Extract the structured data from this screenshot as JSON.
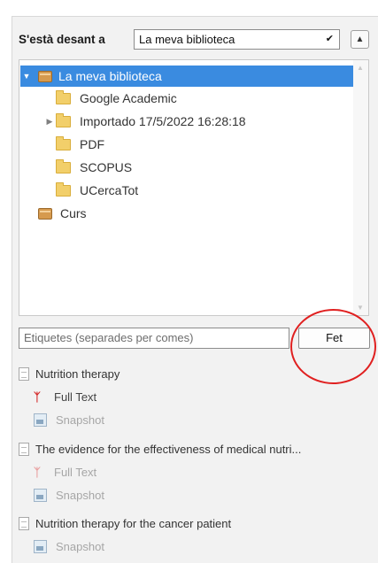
{
  "saving": {
    "label": "S'està desant a",
    "library_select": "La meva biblioteca",
    "collapse_icon": "chevron-up-icon"
  },
  "tree": {
    "items": [
      {
        "label": "La meva biblioteca",
        "type": "library",
        "expanded": true,
        "selected": true
      },
      {
        "label": "Google Academic",
        "type": "collection"
      },
      {
        "label": "Importado 17/5/2022 16:28:18",
        "type": "collection",
        "expanded": false
      },
      {
        "label": "PDF",
        "type": "collection"
      },
      {
        "label": "SCOPUS",
        "type": "collection"
      },
      {
        "label": "UCercaTot",
        "type": "collection"
      },
      {
        "label": "Curs",
        "type": "library"
      }
    ]
  },
  "tags": {
    "placeholder": "Etiquetes (separades per comes)",
    "done_label": "Fet"
  },
  "items": [
    {
      "title": "Nutrition therapy",
      "dim": false,
      "attachments": [
        {
          "label": "Full Text",
          "type": "pdf",
          "dim": false
        },
        {
          "label": "Snapshot",
          "type": "snapshot",
          "dim": true
        }
      ]
    },
    {
      "title": "The evidence for the effectiveness of medical nutri...",
      "dim": false,
      "attachments": [
        {
          "label": "Full Text",
          "type": "pdf",
          "dim": true
        },
        {
          "label": "Snapshot",
          "type": "snapshot",
          "dim": true
        }
      ]
    },
    {
      "title": "Nutrition therapy for the cancer patient",
      "dim": false,
      "attachments": [
        {
          "label": "Snapshot",
          "type": "snapshot",
          "dim": true
        }
      ]
    }
  ],
  "colors": {
    "selection": "#3a8be0",
    "highlight_circle": "#e02020"
  }
}
